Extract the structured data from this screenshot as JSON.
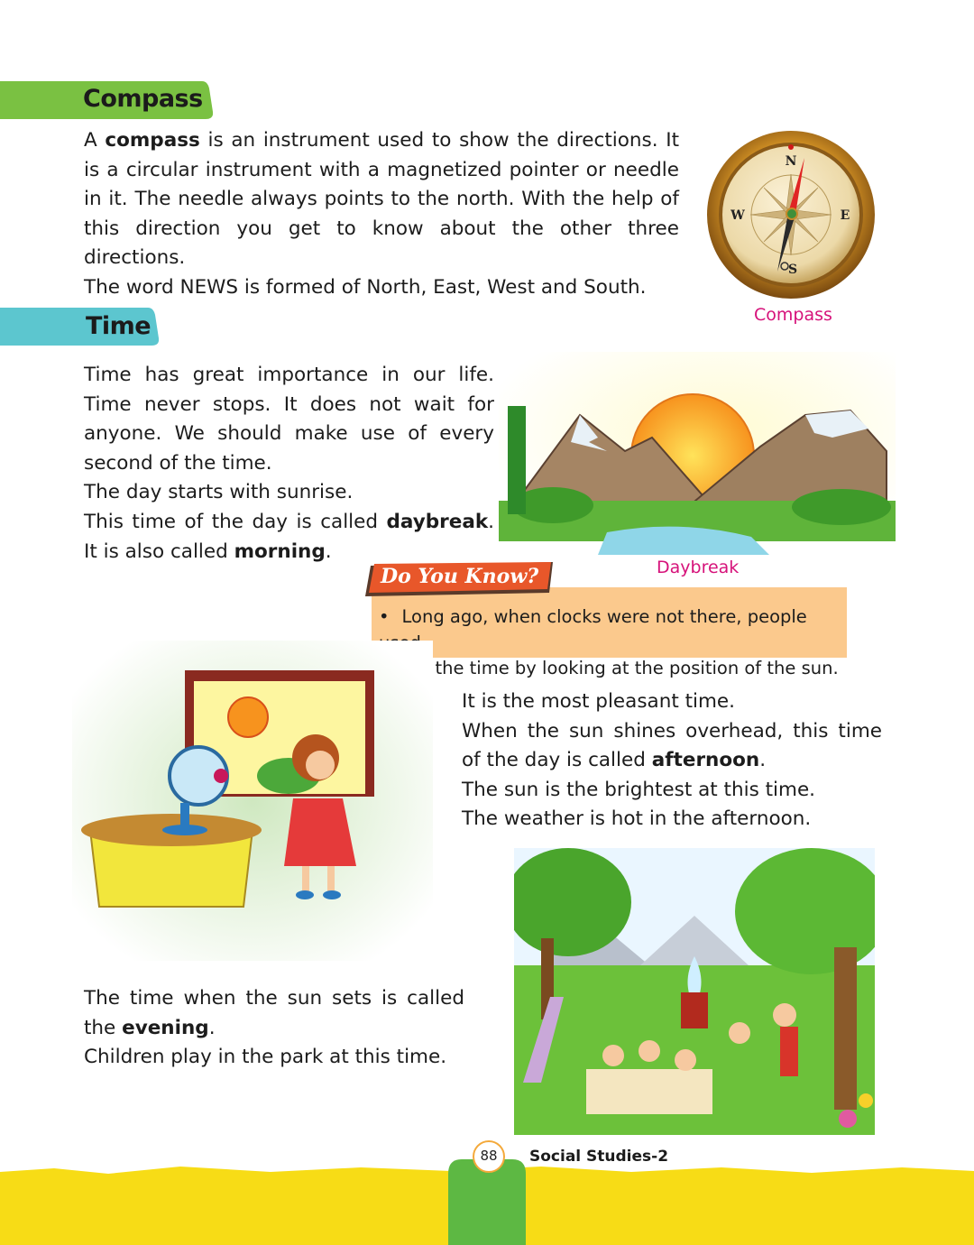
{
  "sections": {
    "compass": {
      "heading": "Compass",
      "para1_pre": "A ",
      "para1_bold": "compass",
      "para1_post": " is an instrument used to show the directions. It is a circular instrument with a magnetized pointer or needle in it. The needle always points to the north. With the help of this direction you get to know about the other three directions.",
      "para2": "The word NEWS is formed of North, East, West and South.",
      "caption": "Compass",
      "letters": {
        "n": "N",
        "e": "E",
        "w": "W",
        "s": "S"
      }
    },
    "time": {
      "heading": "Time",
      "para1": "Time has great importance in our life. Time never stops. It does not wait for anyone. We should make use of every second of the time.",
      "para2": "The day starts with sunrise.",
      "para3_pre": "This time of the day is called ",
      "para3_bold": "daybreak",
      "para3_mid": ". It is also called ",
      "para3_bold2": "morning",
      "para3_end": ".",
      "daybreak_caption": "Daybreak"
    },
    "do_you_know": {
      "title": "Do You Know?",
      "bullet": "•",
      "text_line1": "Long ago, when clocks were not there, people used",
      "text_line2": "to tell the time by looking at the position of the sun."
    },
    "afternoon": {
      "line1": "It is the most pleasant time.",
      "line2_pre": "When the sun shines overhead, this time of the day is called ",
      "line2_bold": "afternoon",
      "line2_end": ".",
      "line3": "The sun is the brightest at this time.",
      "line4": "The weather is hot in the afternoon."
    },
    "evening": {
      "line1_pre": "The time when the sun sets is called the ",
      "line1_bold": "evening",
      "line1_end": ".",
      "line2": "Children play in the park at this time."
    }
  },
  "footer": {
    "page_number": "88",
    "book_title": "Social Studies-2"
  },
  "colors": {
    "compass_tab": "#7ac142",
    "time_tab": "#5cc6cf",
    "caption": "#d6127a",
    "dyk_box": "#fbc98d",
    "dyk_title_bg": "#e8572a",
    "footer_yellow": "#f7dc16",
    "footer_green": "#5db843"
  }
}
